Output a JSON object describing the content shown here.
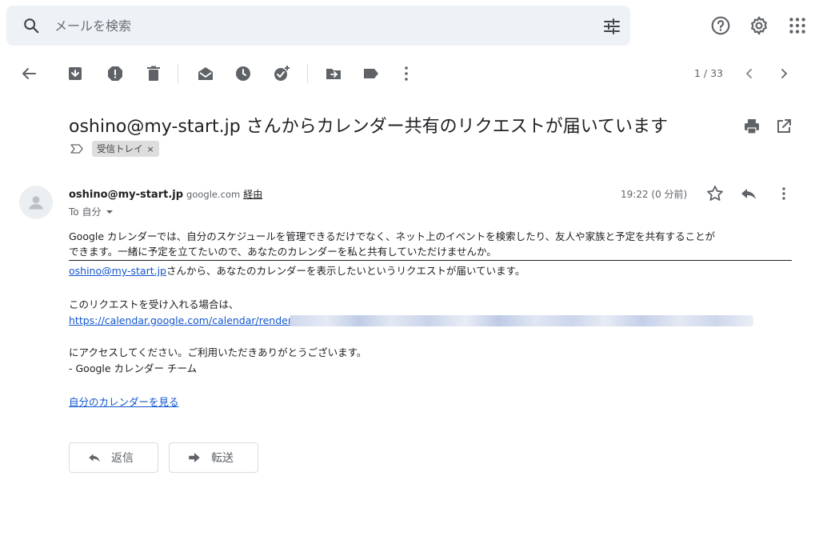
{
  "search": {
    "placeholder": "メールを検索"
  },
  "toolbar": {
    "pager": "1 / 33"
  },
  "message": {
    "subject": "oshino@my-start.jp さんからカレンダー共有のリクエストが届いています",
    "label_chip": "受信トレイ",
    "label_remove": "×",
    "sender_name": "oshino@my-start.jp",
    "sender_domain": "google.com",
    "via_label": "経由",
    "to_label": "To 自分",
    "time": "19:22 (0 分前)",
    "body": {
      "line1": "Google カレンダーでは、自分のスケジュールを管理できるだけでなく、ネット上のイベントを検索したり、友人や家族と予定を共有することが",
      "line2": "できます。一緒に予定を立てたいので、あなたのカレンダーを私と共有していただけませんか。",
      "sender_link": "oshino@my-start.jp",
      "line3_rest": "さんから、あなたのカレンダーを表示したいというリクエストが届いています。",
      "line4": "このリクエストを受け入れる場合は、",
      "calendar_link": "https://calendar.google.com/calendar/render",
      "line5": "にアクセスしてください。ご利用いただきありがとうございます。",
      "line6": "- Google カレンダー チーム",
      "view_calendar_link": "自分のカレンダーを見る"
    }
  },
  "actions": {
    "reply": "返信",
    "forward": "転送"
  },
  "colors": {
    "search_bg": "#eef1f6",
    "link": "#1155cc",
    "icon": "#5f6368"
  }
}
